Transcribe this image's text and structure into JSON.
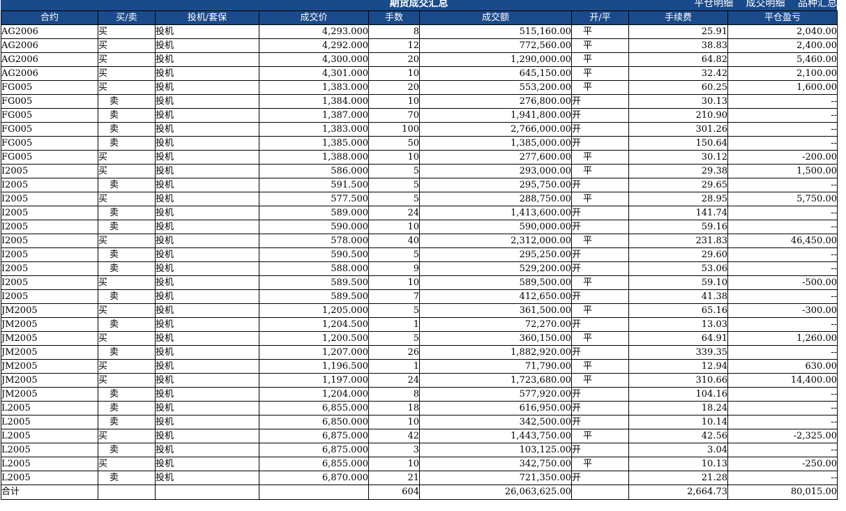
{
  "header": {
    "title": "期货成交汇总",
    "links": [
      "平仓明细",
      "成交明细",
      "品种汇总"
    ]
  },
  "columns": [
    "合约",
    "买/卖",
    "投机/套保",
    "成交价",
    "手数",
    "成交额",
    "开/平",
    "手续费",
    "平仓盈亏"
  ],
  "rows": [
    [
      "AG2006",
      "买",
      "投机",
      "4,293.000",
      "8",
      "515,160.00",
      "平",
      "25.91",
      "2,040.00"
    ],
    [
      "AG2006",
      "买",
      "投机",
      "4,292.000",
      "12",
      "772,560.00",
      "平",
      "38.83",
      "2,400.00"
    ],
    [
      "AG2006",
      "买",
      "投机",
      "4,300.000",
      "20",
      "1,290,000.00",
      "平",
      "64.82",
      "5,460.00"
    ],
    [
      "AG2006",
      "买",
      "投机",
      "4,301.000",
      "10",
      "645,150.00",
      "平",
      "32.42",
      "2,100.00"
    ],
    [
      "FG005",
      "买",
      "投机",
      "1,383.000",
      "20",
      "553,200.00",
      "平",
      "60.25",
      "1,600.00"
    ],
    [
      "FG005",
      "卖",
      "投机",
      "1,384.000",
      "10",
      "276,800.00",
      "开",
      "30.13",
      "--"
    ],
    [
      "FG005",
      "卖",
      "投机",
      "1,387.000",
      "70",
      "1,941,800.00",
      "开",
      "210.90",
      "--"
    ],
    [
      "FG005",
      "卖",
      "投机",
      "1,383.000",
      "100",
      "2,766,000.00",
      "开",
      "301.26",
      "--"
    ],
    [
      "FG005",
      "卖",
      "投机",
      "1,385.000",
      "50",
      "1,385,000.00",
      "开",
      "150.64",
      "--"
    ],
    [
      "FG005",
      "买",
      "投机",
      "1,388.000",
      "10",
      "277,600.00",
      "平",
      "30.12",
      "-200.00"
    ],
    [
      "I2005",
      "买",
      "投机",
      "586.000",
      "5",
      "293,000.00",
      "平",
      "29.38",
      "1,500.00"
    ],
    [
      "I2005",
      "卖",
      "投机",
      "591.500",
      "5",
      "295,750.00",
      "开",
      "29.65",
      "--"
    ],
    [
      "I2005",
      "买",
      "投机",
      "577.500",
      "5",
      "288,750.00",
      "平",
      "28.95",
      "5,750.00"
    ],
    [
      "I2005",
      "卖",
      "投机",
      "589.000",
      "24",
      "1,413,600.00",
      "开",
      "141.74",
      "--"
    ],
    [
      "I2005",
      "卖",
      "投机",
      "590.000",
      "10",
      "590,000.00",
      "开",
      "59.16",
      "--"
    ],
    [
      "I2005",
      "买",
      "投机",
      "578.000",
      "40",
      "2,312,000.00",
      "平",
      "231.83",
      "46,450.00"
    ],
    [
      "I2005",
      "卖",
      "投机",
      "590.500",
      "5",
      "295,250.00",
      "开",
      "29.60",
      "--"
    ],
    [
      "I2005",
      "卖",
      "投机",
      "588.000",
      "9",
      "529,200.00",
      "开",
      "53.06",
      "--"
    ],
    [
      "I2005",
      "买",
      "投机",
      "589.500",
      "10",
      "589,500.00",
      "平",
      "59.10",
      "-500.00"
    ],
    [
      "I2005",
      "卖",
      "投机",
      "589.500",
      "7",
      "412,650.00",
      "开",
      "41.38",
      "--"
    ],
    [
      "JM2005",
      "买",
      "投机",
      "1,205.000",
      "5",
      "361,500.00",
      "平",
      "65.16",
      "-300.00"
    ],
    [
      "JM2005",
      "卖",
      "投机",
      "1,204.500",
      "1",
      "72,270.00",
      "开",
      "13.03",
      "--"
    ],
    [
      "JM2005",
      "买",
      "投机",
      "1,200.500",
      "5",
      "360,150.00",
      "平",
      "64.91",
      "1,260.00"
    ],
    [
      "JM2005",
      "卖",
      "投机",
      "1,207.000",
      "26",
      "1,882,920.00",
      "开",
      "339.35",
      "--"
    ],
    [
      "JM2005",
      "买",
      "投机",
      "1,196.500",
      "1",
      "71,790.00",
      "平",
      "12.94",
      "630.00"
    ],
    [
      "JM2005",
      "买",
      "投机",
      "1,197.000",
      "24",
      "1,723,680.00",
      "平",
      "310.66",
      "14,400.00"
    ],
    [
      "JM2005",
      "卖",
      "投机",
      "1,204.000",
      "8",
      "577,920.00",
      "开",
      "104.16",
      "--"
    ],
    [
      "L2005",
      "卖",
      "投机",
      "6,855.000",
      "18",
      "616,950.00",
      "开",
      "18.24",
      "--"
    ],
    [
      "L2005",
      "卖",
      "投机",
      "6,850.000",
      "10",
      "342,500.00",
      "开",
      "10.14",
      "--"
    ],
    [
      "L2005",
      "买",
      "投机",
      "6,875.000",
      "42",
      "1,443,750.00",
      "平",
      "42.56",
      "-2,325.00"
    ],
    [
      "L2005",
      "卖",
      "投机",
      "6,875.000",
      "3",
      "103,125.00",
      "开",
      "3.04",
      "--"
    ],
    [
      "L2005",
      "买",
      "投机",
      "6,855.000",
      "10",
      "342,750.00",
      "平",
      "10.13",
      "-250.00"
    ],
    [
      "L2005",
      "卖",
      "投机",
      "6,870.000",
      "21",
      "721,350.00",
      "开",
      "21.28",
      "--"
    ]
  ],
  "total": [
    "合计",
    "",
    "",
    "",
    "604",
    "26,063,625.00",
    "",
    "2,664.73",
    "80,015.00"
  ]
}
